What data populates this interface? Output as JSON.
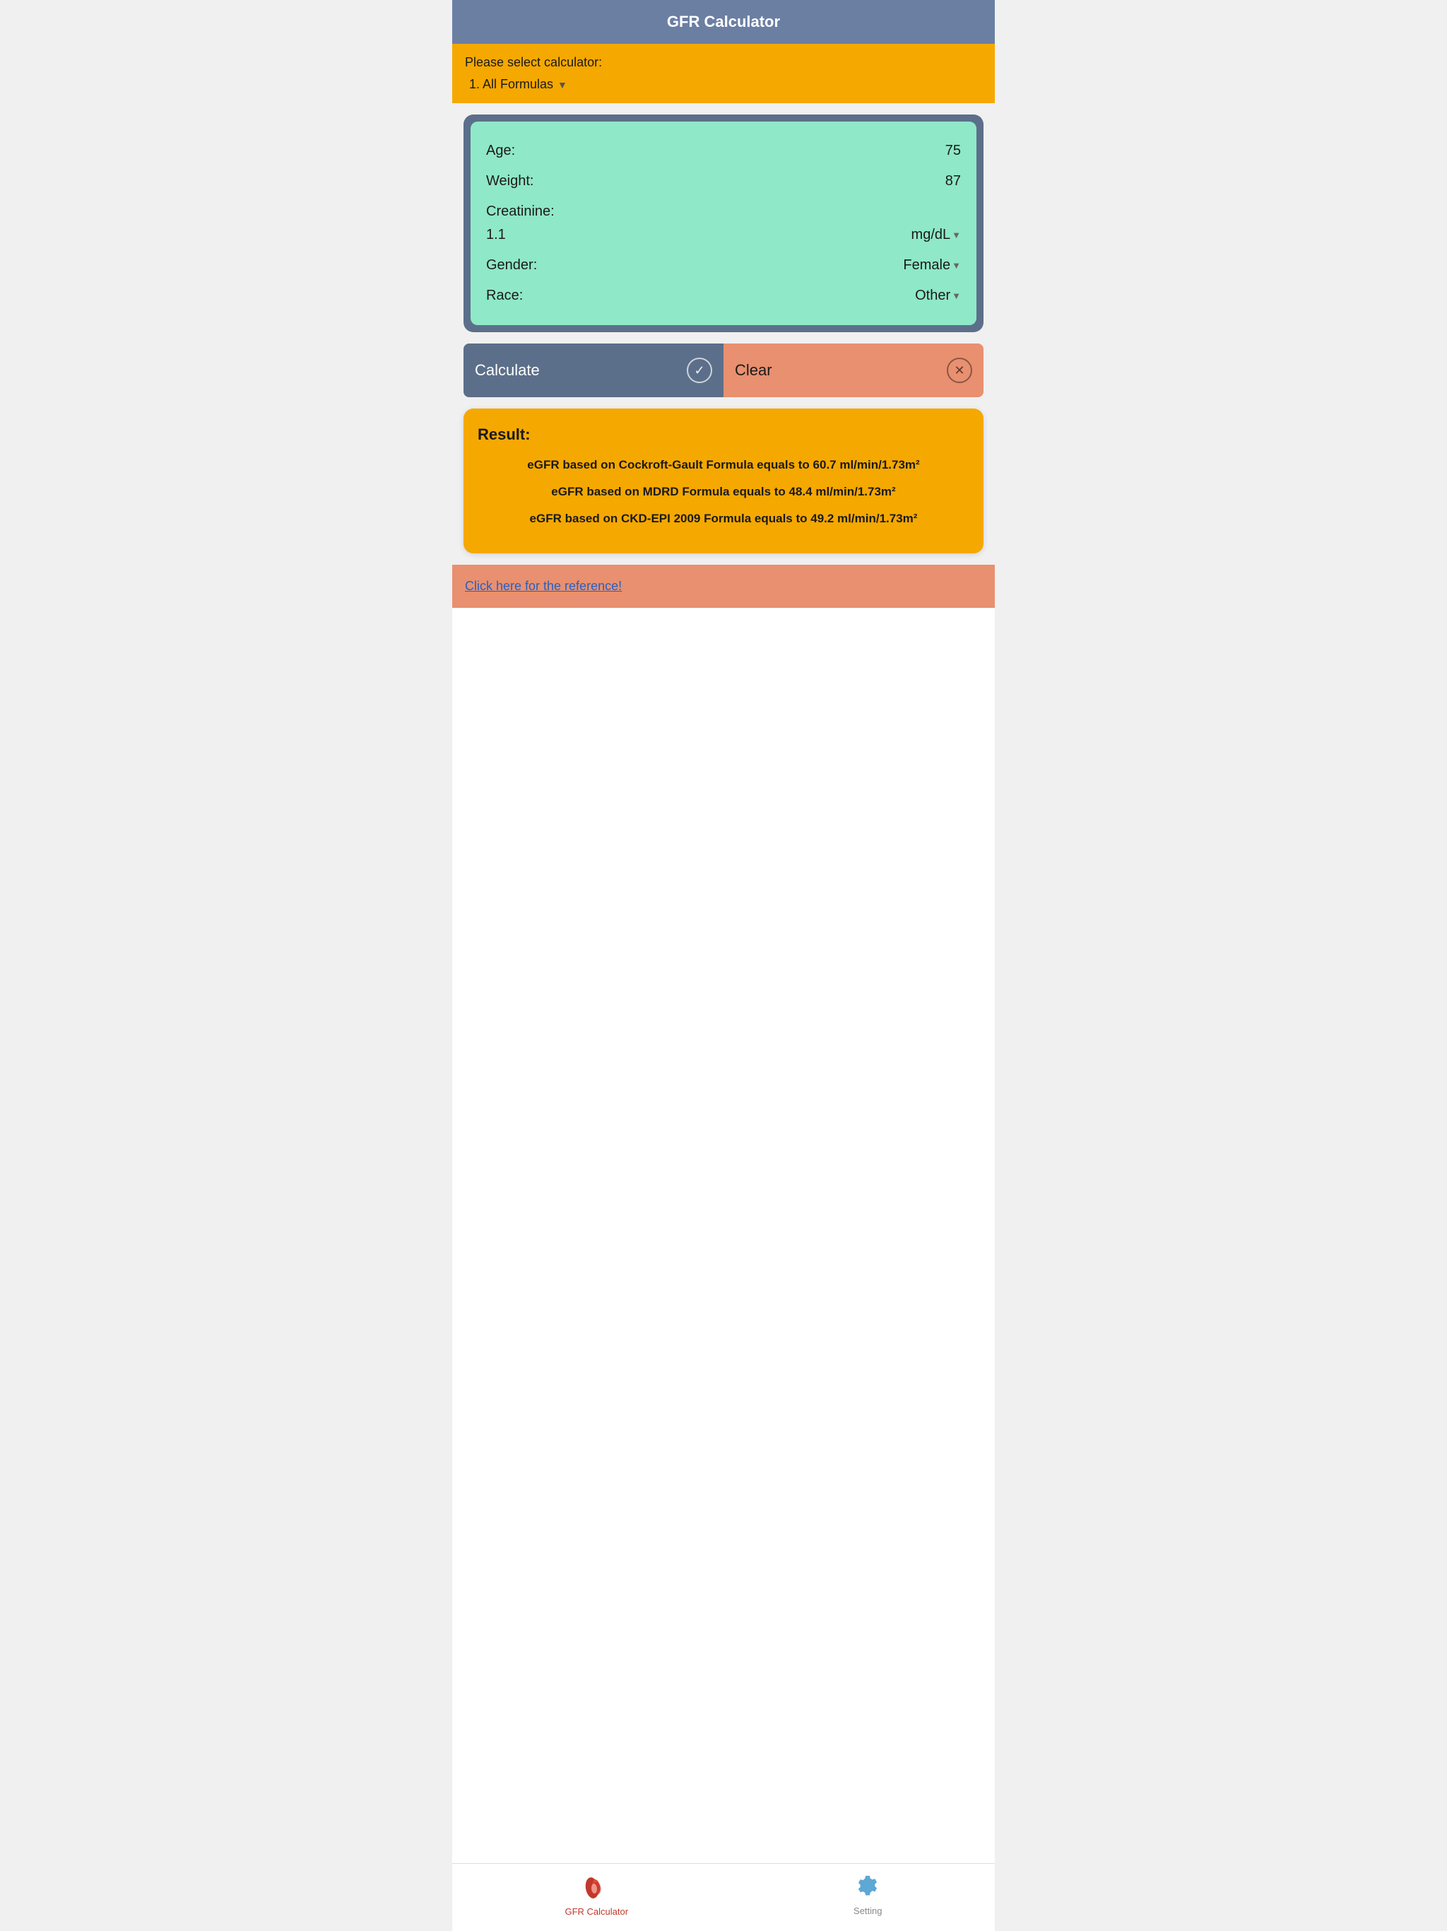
{
  "header": {
    "title": "GFR Calculator"
  },
  "selectBar": {
    "label": "Please select calculator:",
    "selected": "1. All Formulas"
  },
  "inputs": {
    "age": {
      "label": "Age:",
      "value": "75"
    },
    "weight": {
      "label": "Weight:",
      "value": "87"
    },
    "creatinine": {
      "label": "Creatinine:",
      "value": "1.1",
      "unit": "mg/dL"
    },
    "gender": {
      "label": "Gender:",
      "value": "Female"
    },
    "race": {
      "label": "Race:",
      "value": "Other"
    }
  },
  "buttons": {
    "calculate": "Calculate",
    "clear": "Clear"
  },
  "result": {
    "title": "Result:",
    "items": [
      "eGFR based on Cockroft-Gault Formula equals to 60.7 ml/min/1.73m²",
      "eGFR based on MDRD Formula equals to 48.4 ml/min/1.73m²",
      "eGFR based on CKD-EPI 2009 Formula equals to 49.2 ml/min/1.73m²"
    ]
  },
  "reference": {
    "link": "Click here for the reference!"
  },
  "bottomNav": {
    "items": [
      {
        "label": "GFR Calculator",
        "active": true
      },
      {
        "label": "Setting",
        "active": false
      }
    ]
  }
}
